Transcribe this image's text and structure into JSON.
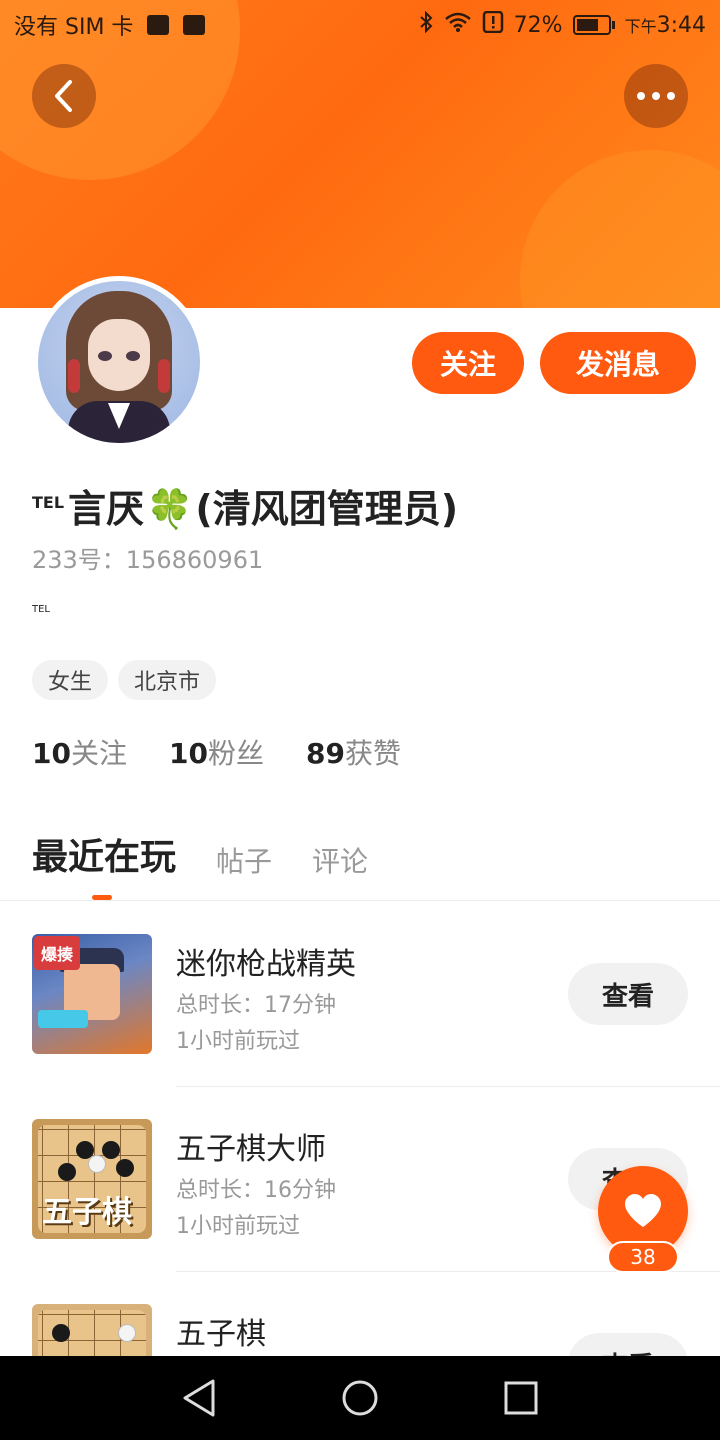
{
  "status_bar": {
    "carrier": "没有 SIM 卡",
    "battery": "72%",
    "time_prefix": "下午",
    "time": "3:44",
    "icons": [
      "huawei-store-icon",
      "gallery-icon",
      "bluetooth-icon",
      "wifi-icon",
      "alert-icon",
      "battery-icon"
    ]
  },
  "header": {
    "back_icon": "chevron-left-icon",
    "more_icon": "more-dots-icon",
    "accent_color": "#ff6a10"
  },
  "profile": {
    "tel_badge": "TEL",
    "name_prefix": "言厌",
    "clover": "🍀",
    "name_suffix": "(清风团管理员)",
    "id_text": "233号：156860961",
    "bio": "TEL",
    "tags": [
      "女生",
      "北京市"
    ],
    "follow_label": "关注",
    "message_label": "发消息"
  },
  "stats": [
    {
      "num": "10",
      "label": "关注"
    },
    {
      "num": "10",
      "label": "粉丝"
    },
    {
      "num": "89",
      "label": "获赞"
    }
  ],
  "tabs": [
    {
      "label": "最近在玩",
      "active": true
    },
    {
      "label": "帖子",
      "active": false
    },
    {
      "label": "评论",
      "active": false
    }
  ],
  "games": [
    {
      "name": "迷你枪战精英",
      "duration": "总时长：17分钟",
      "last_played": "1小时前玩过",
      "action": "查看",
      "badge": "爆揍"
    },
    {
      "name": "五子棋大师",
      "duration": "总时长：16分钟",
      "last_played": "1小时前玩过",
      "action": "查看",
      "logo": "五子棋"
    },
    {
      "name": "五子棋",
      "duration": "",
      "last_played": "",
      "action": "查看"
    }
  ],
  "like": {
    "count": "38",
    "icon": "heart-icon"
  },
  "nav_bar": {
    "icons": [
      "back-triangle-icon",
      "home-circle-icon",
      "recents-square-icon"
    ]
  }
}
